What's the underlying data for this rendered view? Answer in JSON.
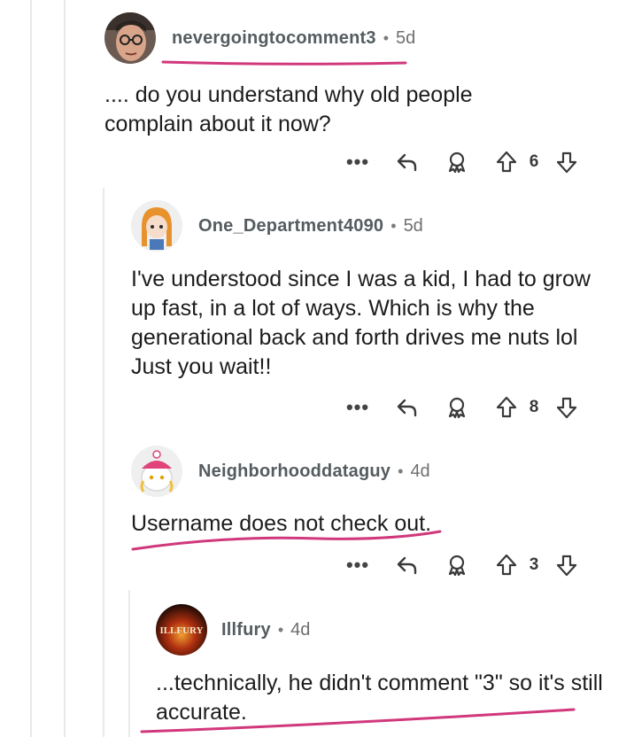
{
  "comments": [
    {
      "username": "nevergoingtocomment3",
      "age": "5d",
      "body": ".... do you understand why old people complain about it now?",
      "votes": "6"
    },
    {
      "username": "One_Department4090",
      "age": "5d",
      "body": "I've understood since I was a kid, I had to grow up fast, in a lot of ways.  Which is why the generational back and forth drives me nuts lol  Just you wait!!",
      "votes": "8"
    },
    {
      "username": "Neighborhooddataguy",
      "age": "4d",
      "body": "Username does not check out.",
      "votes": "3"
    },
    {
      "username": "Illfury",
      "age": "4d",
      "body": "...technically, he didn't comment \"3\" so it's still accurate.",
      "avatar_text": "ILLFURY"
    }
  ],
  "separator": "•",
  "more_label": "•••",
  "colors": {
    "annotation": "#d1387c",
    "thread_line": "#e9e9e9",
    "username": "#555c60"
  },
  "icons": [
    "reply-icon",
    "award-icon",
    "upvote-icon",
    "downvote-icon",
    "more-icon"
  ]
}
